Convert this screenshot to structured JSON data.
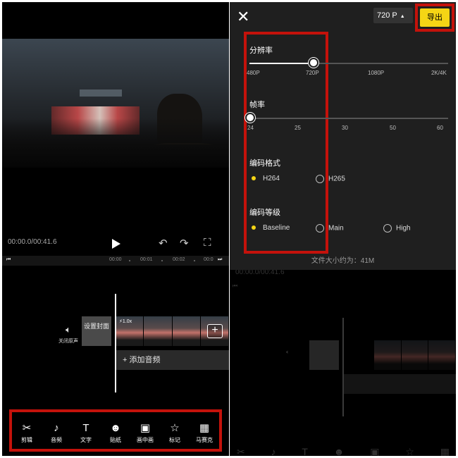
{
  "left": {
    "timecode": "00:00.0/00:41.6",
    "ruler": [
      "00:00",
      "00:01",
      "00:02",
      "00:0"
    ],
    "mute_label": "关闭原声",
    "cover_label": "设置封面",
    "speed_label": "1.0x",
    "add_audio_label": "+ 添加音频",
    "tools": [
      {
        "icon": "scissors-icon",
        "glyph": "✂",
        "label": "剪辑"
      },
      {
        "icon": "music-note-icon",
        "glyph": "♪",
        "label": "音频"
      },
      {
        "icon": "text-icon",
        "glyph": "T",
        "label": "文字"
      },
      {
        "icon": "smiley-icon",
        "glyph": "☻",
        "label": "贴纸"
      },
      {
        "icon": "picture-in-picture-icon",
        "glyph": "▣",
        "label": "画中画"
      },
      {
        "icon": "star-badge-icon",
        "glyph": "☆",
        "label": "标记"
      },
      {
        "icon": "mosaic-icon",
        "glyph": "▦",
        "label": "马赛克"
      }
    ]
  },
  "right": {
    "resolution_value": "720 P",
    "export_label": "导出",
    "resolution": {
      "title": "分辨率",
      "ticks": [
        "480P",
        "720P",
        "1080P",
        "2K/4K"
      ],
      "selected": "720P"
    },
    "framerate": {
      "title": "帧率",
      "ticks": [
        "24",
        "25",
        "30",
        "50",
        "60"
      ],
      "selected": "24"
    },
    "codec": {
      "title": "编码格式",
      "options": [
        "H264",
        "H265"
      ],
      "selected": "H264"
    },
    "profile": {
      "title": "编码等级",
      "options": [
        "Baseline",
        "Main",
        "High"
      ],
      "selected": "Baseline"
    },
    "file_size": "文件大小约为：41M"
  },
  "colors": {
    "highlight_red": "#c4120b",
    "accent_yellow": "#f5d515",
    "sheet_bg": "#1f1f1f"
  }
}
